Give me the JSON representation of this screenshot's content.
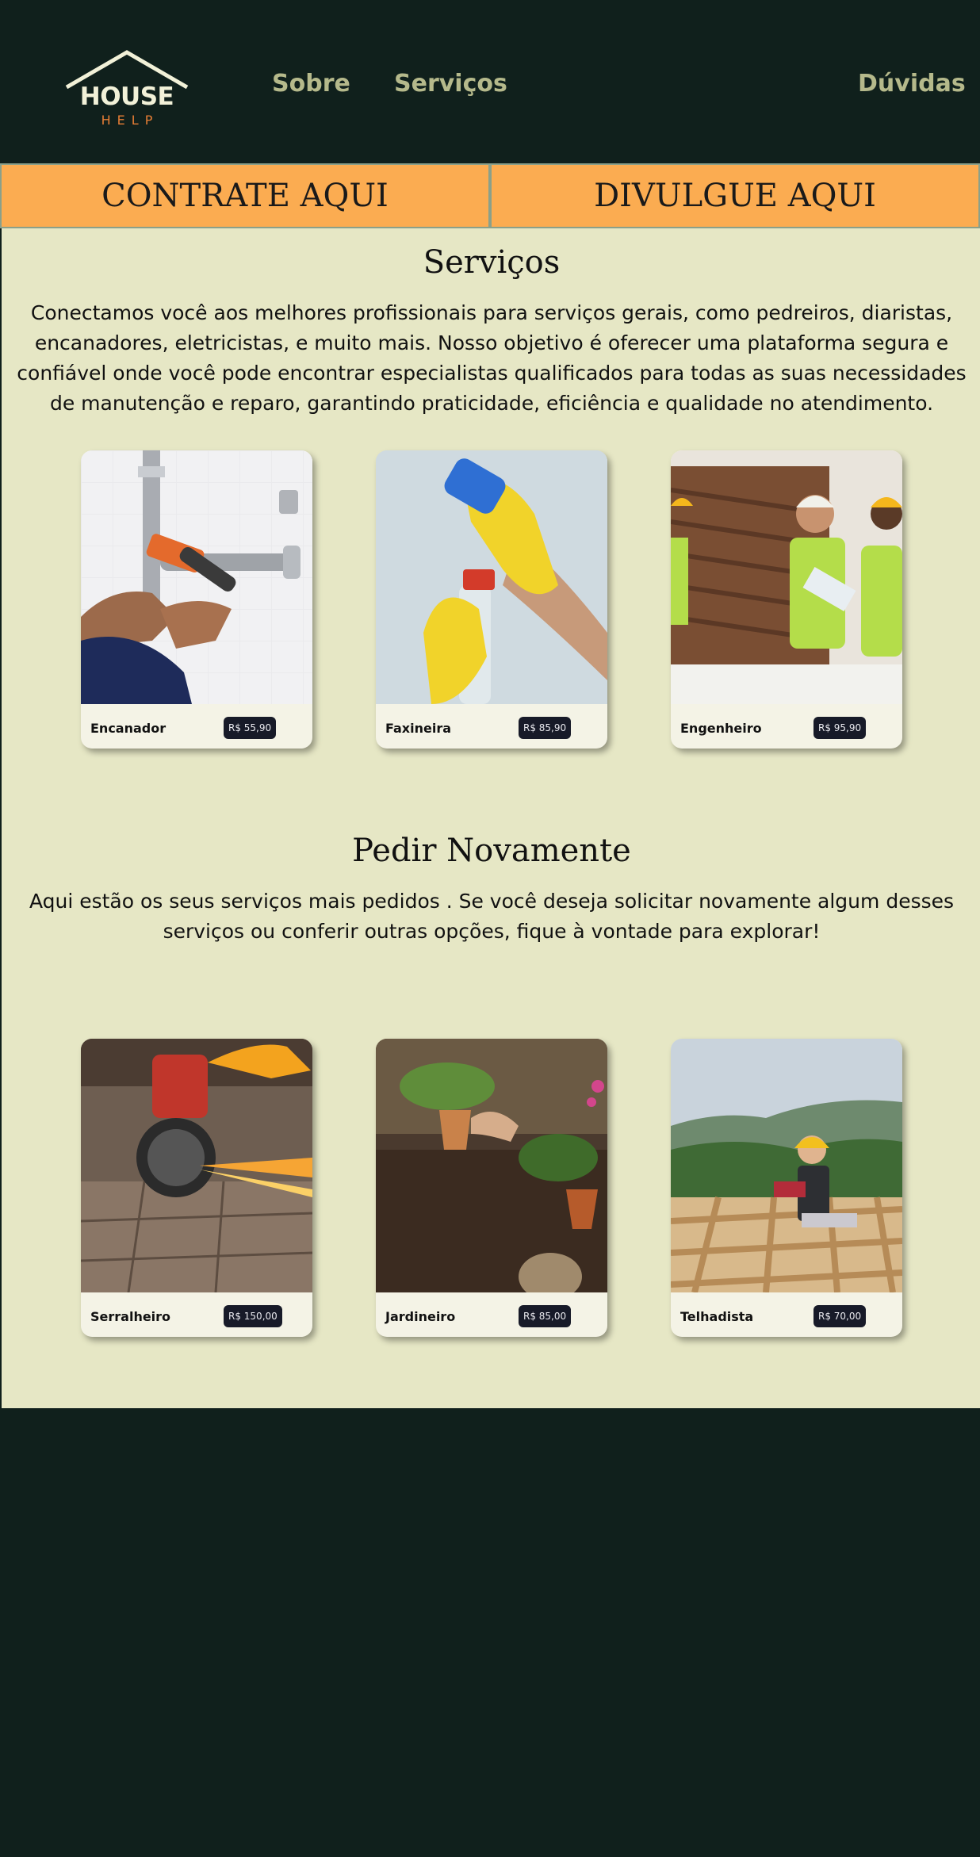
{
  "header": {
    "logo_text": "HOUSE",
    "logo_sub": "HELP",
    "nav": {
      "sobre": "Sobre",
      "servicos": "Serviços",
      "duvidas": "Dúvidas"
    }
  },
  "cta": {
    "contrate": "CONTRATE AQUI",
    "divulgue": "DIVULGUE AQUI"
  },
  "servicos": {
    "title": "Serviços",
    "text": "Conectamos você aos melhores profissionais para serviços gerais, como pedreiros, diaristas, encanadores, eletricistas, e muito mais. Nosso objetivo é oferecer uma plataforma segura e confiável onde você pode encontrar especialistas qualificados para todas as suas necessidades de manutenção e reparo, garantindo praticidade, eficiência e qualidade no atendimento.",
    "cards": [
      {
        "name": "Encanador",
        "price": "R$ 55,90",
        "icon": "plumber-photo"
      },
      {
        "name": "Faxineira",
        "price": "R$ 85,90",
        "icon": "cleaner-photo"
      },
      {
        "name": "Engenheiro",
        "price": "R$ 95,90",
        "icon": "engineer-photo"
      }
    ]
  },
  "pedir": {
    "title": "Pedir Novamente",
    "text": "Aqui estão os seus serviços mais pedidos . Se você deseja solicitar novamente algum desses serviços ou conferir outras opções, fique à vontade para explorar!",
    "cards": [
      {
        "name": "Serralheiro",
        "price": "R$ 150,00",
        "icon": "locksmith-photo"
      },
      {
        "name": "Jardineiro",
        "price": "R$ 85,00",
        "icon": "gardener-photo"
      },
      {
        "name": "Telhadista",
        "price": "R$ 70,00",
        "icon": "roofer-photo"
      }
    ]
  },
  "colors": {
    "dark_bg": "#10201c",
    "content_bg": "#e6e7c5",
    "cta": "#fbac51",
    "accent": "#e77e35",
    "nav": "#b5b98b"
  }
}
